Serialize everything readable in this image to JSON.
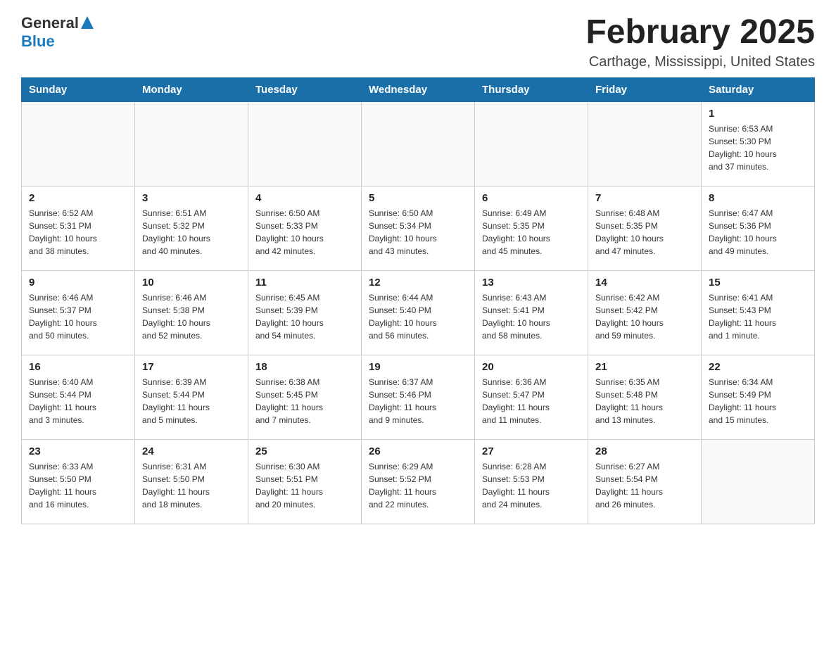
{
  "header": {
    "logo_general": "General",
    "logo_blue": "Blue",
    "title": "February 2025",
    "subtitle": "Carthage, Mississippi, United States"
  },
  "weekdays": [
    "Sunday",
    "Monday",
    "Tuesday",
    "Wednesday",
    "Thursday",
    "Friday",
    "Saturday"
  ],
  "weeks": [
    [
      {
        "day": "",
        "info": ""
      },
      {
        "day": "",
        "info": ""
      },
      {
        "day": "",
        "info": ""
      },
      {
        "day": "",
        "info": ""
      },
      {
        "day": "",
        "info": ""
      },
      {
        "day": "",
        "info": ""
      },
      {
        "day": "1",
        "info": "Sunrise: 6:53 AM\nSunset: 5:30 PM\nDaylight: 10 hours\nand 37 minutes."
      }
    ],
    [
      {
        "day": "2",
        "info": "Sunrise: 6:52 AM\nSunset: 5:31 PM\nDaylight: 10 hours\nand 38 minutes."
      },
      {
        "day": "3",
        "info": "Sunrise: 6:51 AM\nSunset: 5:32 PM\nDaylight: 10 hours\nand 40 minutes."
      },
      {
        "day": "4",
        "info": "Sunrise: 6:50 AM\nSunset: 5:33 PM\nDaylight: 10 hours\nand 42 minutes."
      },
      {
        "day": "5",
        "info": "Sunrise: 6:50 AM\nSunset: 5:34 PM\nDaylight: 10 hours\nand 43 minutes."
      },
      {
        "day": "6",
        "info": "Sunrise: 6:49 AM\nSunset: 5:35 PM\nDaylight: 10 hours\nand 45 minutes."
      },
      {
        "day": "7",
        "info": "Sunrise: 6:48 AM\nSunset: 5:35 PM\nDaylight: 10 hours\nand 47 minutes."
      },
      {
        "day": "8",
        "info": "Sunrise: 6:47 AM\nSunset: 5:36 PM\nDaylight: 10 hours\nand 49 minutes."
      }
    ],
    [
      {
        "day": "9",
        "info": "Sunrise: 6:46 AM\nSunset: 5:37 PM\nDaylight: 10 hours\nand 50 minutes."
      },
      {
        "day": "10",
        "info": "Sunrise: 6:46 AM\nSunset: 5:38 PM\nDaylight: 10 hours\nand 52 minutes."
      },
      {
        "day": "11",
        "info": "Sunrise: 6:45 AM\nSunset: 5:39 PM\nDaylight: 10 hours\nand 54 minutes."
      },
      {
        "day": "12",
        "info": "Sunrise: 6:44 AM\nSunset: 5:40 PM\nDaylight: 10 hours\nand 56 minutes."
      },
      {
        "day": "13",
        "info": "Sunrise: 6:43 AM\nSunset: 5:41 PM\nDaylight: 10 hours\nand 58 minutes."
      },
      {
        "day": "14",
        "info": "Sunrise: 6:42 AM\nSunset: 5:42 PM\nDaylight: 10 hours\nand 59 minutes."
      },
      {
        "day": "15",
        "info": "Sunrise: 6:41 AM\nSunset: 5:43 PM\nDaylight: 11 hours\nand 1 minute."
      }
    ],
    [
      {
        "day": "16",
        "info": "Sunrise: 6:40 AM\nSunset: 5:44 PM\nDaylight: 11 hours\nand 3 minutes."
      },
      {
        "day": "17",
        "info": "Sunrise: 6:39 AM\nSunset: 5:44 PM\nDaylight: 11 hours\nand 5 minutes."
      },
      {
        "day": "18",
        "info": "Sunrise: 6:38 AM\nSunset: 5:45 PM\nDaylight: 11 hours\nand 7 minutes."
      },
      {
        "day": "19",
        "info": "Sunrise: 6:37 AM\nSunset: 5:46 PM\nDaylight: 11 hours\nand 9 minutes."
      },
      {
        "day": "20",
        "info": "Sunrise: 6:36 AM\nSunset: 5:47 PM\nDaylight: 11 hours\nand 11 minutes."
      },
      {
        "day": "21",
        "info": "Sunrise: 6:35 AM\nSunset: 5:48 PM\nDaylight: 11 hours\nand 13 minutes."
      },
      {
        "day": "22",
        "info": "Sunrise: 6:34 AM\nSunset: 5:49 PM\nDaylight: 11 hours\nand 15 minutes."
      }
    ],
    [
      {
        "day": "23",
        "info": "Sunrise: 6:33 AM\nSunset: 5:50 PM\nDaylight: 11 hours\nand 16 minutes."
      },
      {
        "day": "24",
        "info": "Sunrise: 6:31 AM\nSunset: 5:50 PM\nDaylight: 11 hours\nand 18 minutes."
      },
      {
        "day": "25",
        "info": "Sunrise: 6:30 AM\nSunset: 5:51 PM\nDaylight: 11 hours\nand 20 minutes."
      },
      {
        "day": "26",
        "info": "Sunrise: 6:29 AM\nSunset: 5:52 PM\nDaylight: 11 hours\nand 22 minutes."
      },
      {
        "day": "27",
        "info": "Sunrise: 6:28 AM\nSunset: 5:53 PM\nDaylight: 11 hours\nand 24 minutes."
      },
      {
        "day": "28",
        "info": "Sunrise: 6:27 AM\nSunset: 5:54 PM\nDaylight: 11 hours\nand 26 minutes."
      },
      {
        "day": "",
        "info": ""
      }
    ]
  ]
}
